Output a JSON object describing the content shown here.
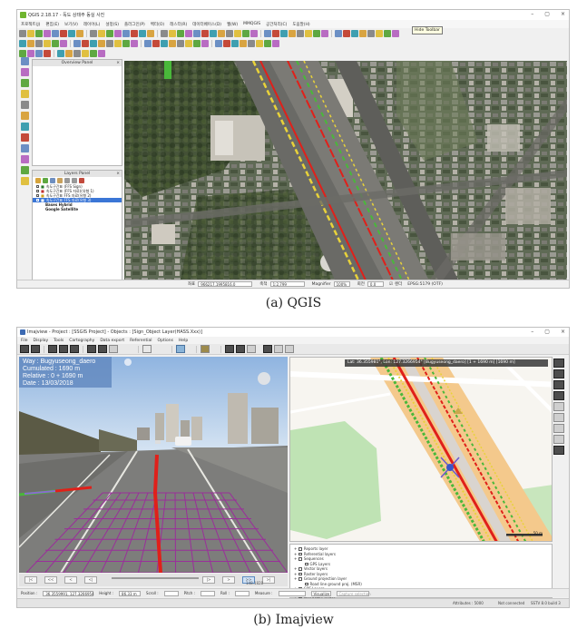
{
  "qgis": {
    "window_title": "QGIS 2.18.17 - 독도 상태주 동실 사진",
    "menus": [
      "프로젝트(J)",
      "편집(E)",
      "보기(V)",
      "레이어(L)",
      "설정(S)",
      "플러그인(P)",
      "벡터(O)",
      "래스터(R)",
      "데이터베이스(D)",
      "웹(W)",
      "MMQGIS",
      "공간처리(C)",
      "도움말(H)"
    ],
    "tooltip": "Hide Toolbar",
    "overview_panel_title": "Overview Panel",
    "layers_panel_title": "Layers Panel",
    "layers": [
      {
        "name": "속도구간표 (FFS Sign)",
        "selected": false
      },
      {
        "name": "속도구간표 (FFS 자료)(유형 1)",
        "selected": false
      },
      {
        "name": "속도구간표 FFS 자료(유형 2)",
        "selected": false
      },
      {
        "name": "속도구간표 FFS 자료(유형 3)",
        "selected": true
      },
      {
        "name": "Bases Hybrid",
        "selected": false
      },
      {
        "name": "Google Satellite",
        "selected": false
      }
    ],
    "status": {
      "coord_label": "좌표",
      "coord_value": "966217.1995816.0",
      "scale_label": "축척",
      "scale_value": "1:2,799",
      "magnifier_label": "Magnifier",
      "magnifier_value": "100%",
      "rotation_label": "회전",
      "rotation_value": "0.0",
      "render_label": "렌더",
      "crs_label": "EPSG:5179 (OTF)"
    }
  },
  "captions": {
    "a": "(a)  QGIS",
    "b": "(b)  Imajview"
  },
  "imajview": {
    "window_title": "Imajview - Project : [SSGIS Project] - Objects : [Sign_Object Layer(HASS.Xxx)]",
    "menus": [
      "File",
      "Display",
      "Tools",
      "Cartography",
      "Data export",
      "Referential",
      "Options",
      "Help"
    ],
    "overlay": {
      "way": "Way : Bugyuseong_daero",
      "cumulated": "Cumulated : 1690 m",
      "relative": "Relative : 0 + 1690 m",
      "date": "Date : 13/03/2018"
    },
    "map_coord": "Lat: 36.355981°, Lon: 127.3266954°   [Bugyuseong_daero]   [1 + 1690 m]   [1690 m]",
    "scale_text": "50 m",
    "layers": [
      {
        "name": "Reports layer",
        "level": 0
      },
      {
        "name": "Referential layers",
        "level": 0
      },
      {
        "name": "Sequences",
        "level": 0
      },
      {
        "name": "GPS Layers",
        "level": 1
      },
      {
        "name": "Vector layers",
        "level": 0
      },
      {
        "name": "Raster layers",
        "level": 0
      },
      {
        "name": "Ground projection layer",
        "level": 0
      },
      {
        "name": "Road line ground proj. (MSR)",
        "level": 1
      },
      {
        "name": "GPS Layers",
        "level": 0
      },
      {
        "name": "Raster layers",
        "level": 0
      },
      {
        "name": "Plan/Ortho raster",
        "level": 0
      },
      {
        "name": "Bugyuseong_daero",
        "level": 1
      }
    ],
    "video_buttons": [
      "|<",
      "<<",
      "<",
      "<|",
      "|>",
      ">",
      ">>",
      ">|"
    ],
    "time_text": "148.1828",
    "bottom_bar": {
      "position_label": "Position :",
      "position_value": "36.3559991, 127.3266954",
      "height_label": "Height :",
      "height_value": "86.33 m",
      "scroll_label": "Scroll :",
      "pitch_label": "Pitch :",
      "roll_label": "Roll :",
      "measure_label": "Measure :",
      "visualize_button": "Visualize",
      "capture_button": "Capture selection"
    },
    "status": {
      "left": "",
      "objects": "Attributes : 5000",
      "connection": "Not connected",
      "version": "SSTV 8.0 build 3"
    }
  },
  "colors": {
    "road_red": "#e0201a",
    "road_green": "#49b83a",
    "road_yellow": "#e8d23a",
    "grid_purple": "#9a2f9a",
    "sky_blue": "#8fb4e0",
    "map_road": "#f4c98c"
  }
}
